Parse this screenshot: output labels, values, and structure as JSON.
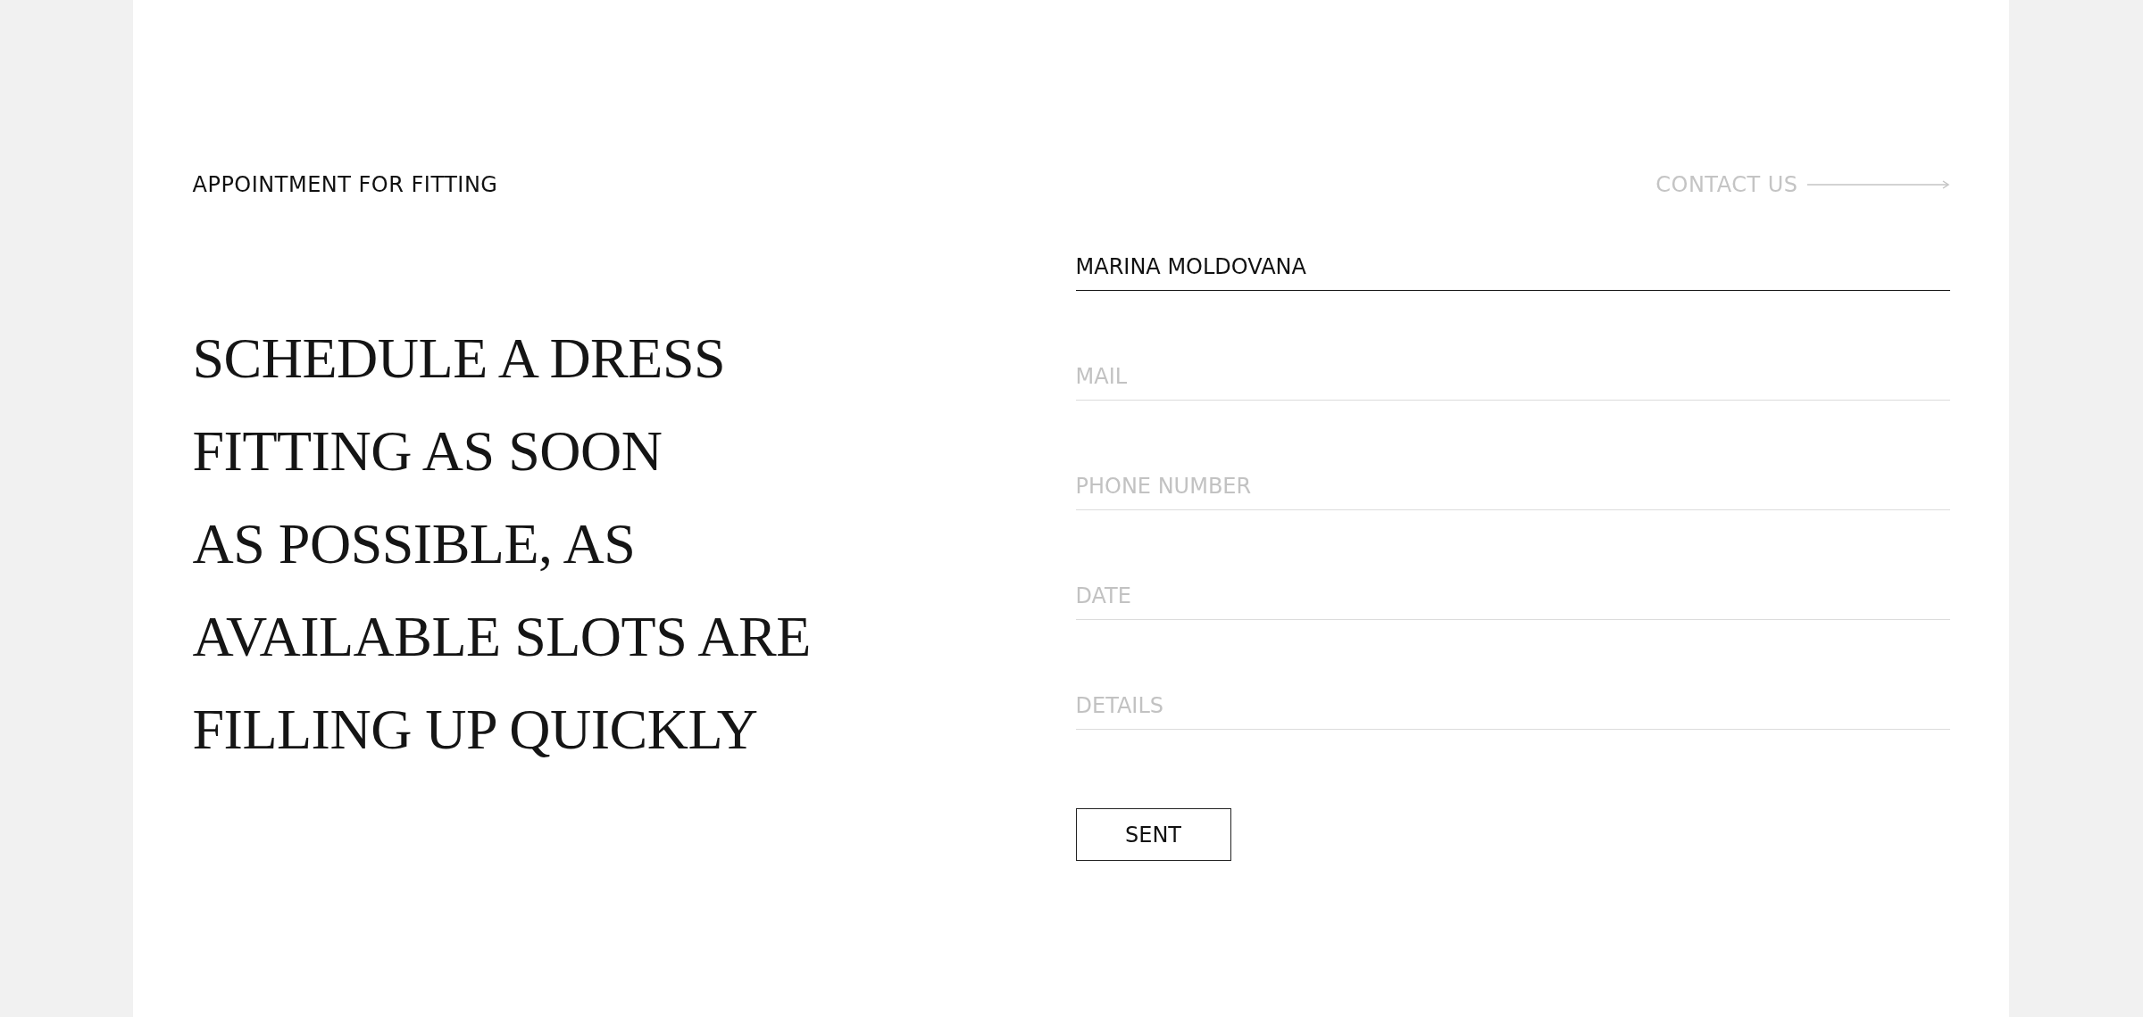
{
  "header": {
    "title": "APPOINTMENT FOR FITTING",
    "contact_link": "CONTACT US"
  },
  "headline_lines": [
    "SCHEDULE A DRESS",
    "FITTING AS SOON",
    "AS POSSIBLE, AS",
    "AVAILABLE SLOTS ARE",
    "FILLING UP QUICKLY"
  ],
  "form": {
    "fields": [
      {
        "value": "MARINA MOLDOVANA"
      },
      {
        "placeholder": "MAIL"
      },
      {
        "placeholder": "PHONE NUMBER"
      },
      {
        "placeholder": "DATE"
      },
      {
        "placeholder": "DETAILS"
      }
    ],
    "submit": "SENT"
  }
}
